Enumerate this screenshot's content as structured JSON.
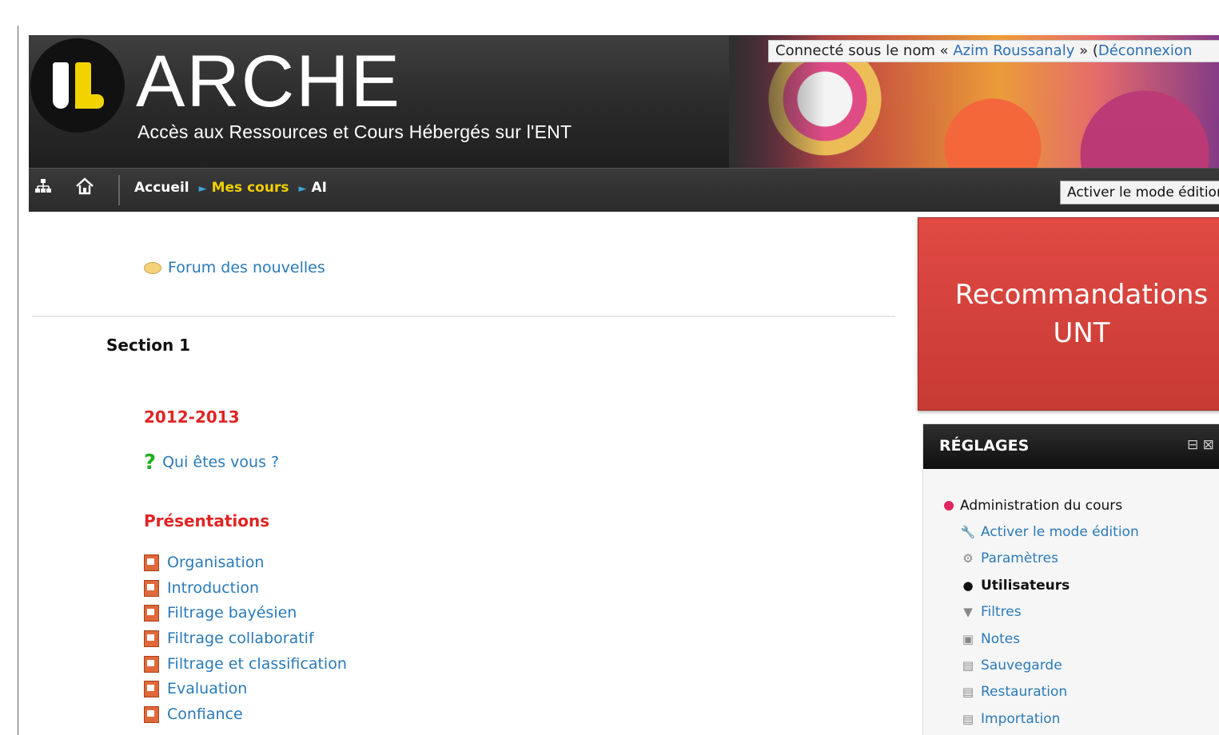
{
  "header": {
    "title": "ARCHE",
    "subtitle": "Accès aux Ressources et Cours Hébergés sur l'ENT",
    "login": {
      "prefix": "Connecté sous le nom «",
      "user": "Azim Roussanaly",
      "middle": "» (",
      "logout": "Déconnexion"
    }
  },
  "nav": {
    "sitemap_icon": "sitemap-icon",
    "home_icon": "home-icon",
    "breadcrumbs": [
      "Accueil",
      "Mes cours",
      "AI"
    ],
    "edit_button": "Activer le mode édition"
  },
  "main": {
    "forum": "Forum des nouvelles",
    "section_title": "Section 1",
    "year": "2012-2013",
    "quiz": "Qui êtes vous ?",
    "presentations_title": "Présentations",
    "resources": [
      "Organisation",
      "Introduction",
      "Filtrage bayésien",
      "Filtrage collaboratif",
      "Filtrage et classification",
      "Evaluation",
      "Confiance"
    ]
  },
  "right": {
    "reco_line1": "Recommandations",
    "reco_line2": "UNT",
    "settings": {
      "title": "RÉGLAGES",
      "admin_title": "Administration du cours",
      "items": [
        {
          "label": "Activer le mode édition",
          "icon": "wrench-icon"
        },
        {
          "label": "Paramètres",
          "icon": "gear-icon"
        },
        {
          "label": "Utilisateurs",
          "icon": "user-circle-icon"
        },
        {
          "label": "Filtres",
          "icon": "filter-icon"
        },
        {
          "label": "Notes",
          "icon": "grades-icon"
        },
        {
          "label": "Sauvegarde",
          "icon": "backup-icon"
        },
        {
          "label": "Restauration",
          "icon": "restore-icon"
        },
        {
          "label": "Importation",
          "icon": "import-icon"
        }
      ]
    }
  }
}
